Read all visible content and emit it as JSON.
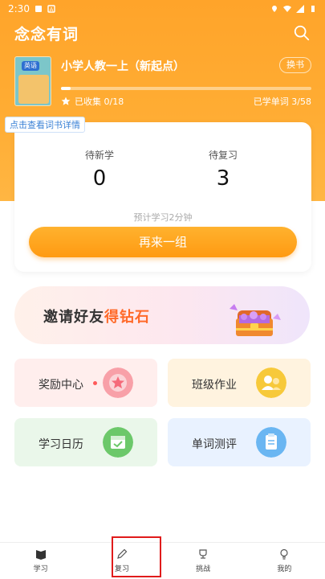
{
  "status_bar": {
    "time": "2:30"
  },
  "header": {
    "title": "念念有词"
  },
  "book": {
    "cover_tag": "英语",
    "title": "小学人教一上（新起点）",
    "change_label": "换书",
    "progress": 0.04,
    "collected": "已收集 0/18",
    "learned": "已学单词 3/58",
    "tip": "点击查看词书详情"
  },
  "stats": {
    "new_label": "待新学",
    "new_value": "0",
    "review_label": "待复习",
    "review_value": "3",
    "estimate": "预计学习2分钟",
    "again_label": "再来一组"
  },
  "invite": {
    "text_prefix": "邀请好友",
    "text_accent": "得钻石"
  },
  "tiles": {
    "reward": "奖励中心",
    "homework": "班级作业",
    "calendar": "学习日历",
    "test": "单词测评"
  },
  "tabs": {
    "learn": "学习",
    "review": "复习",
    "challenge": "挑战",
    "mine": "我的"
  },
  "colors": {
    "accent": "#ffa42a",
    "highlight": "#e01b1b",
    "link": "#3b82d6"
  }
}
